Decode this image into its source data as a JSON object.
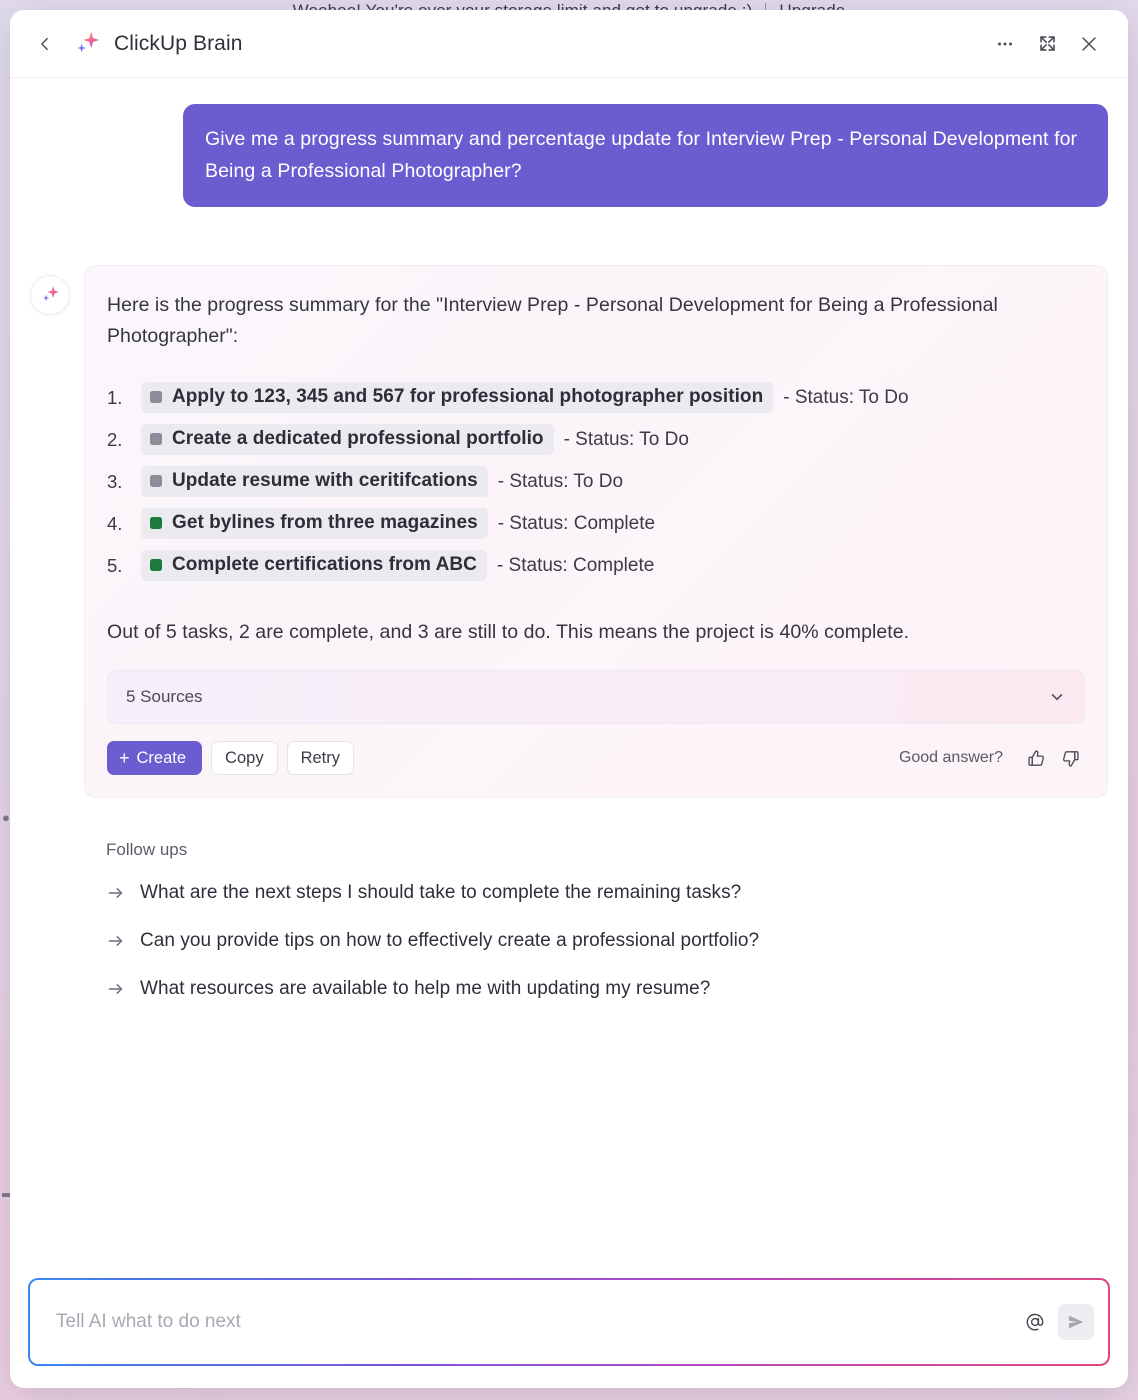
{
  "backdrop": {
    "banner_text": "Woohoo! You're over your storage limit and get to upgrade :)",
    "banner_action": "Upgrade"
  },
  "header": {
    "title": "ClickUp Brain",
    "back_icon": "chevron-left-icon",
    "brand_icon": "sparkles-icon",
    "more_icon": "more-horizontal-icon",
    "expand_icon": "expand-icon",
    "close_icon": "close-icon"
  },
  "conversation": {
    "user_message": "Give me a progress summary and percentage update for Interview Prep - Personal Development for Being a Professional Photographer?",
    "assistant": {
      "intro": "Here is the progress summary for the \"Interview Prep - Personal Development for Being a Professional Photographer\":",
      "tasks": [
        {
          "number": "1.",
          "name": "Apply to 123, 345 and 567 for professional photographer position",
          "status_text": "- Status: To Do",
          "status": "To Do",
          "color": "#8d8d99"
        },
        {
          "number": "2.",
          "name": "Create a dedicated professional portfolio",
          "status_text": "- Status: To Do",
          "status": "To Do",
          "color": "#8d8d99"
        },
        {
          "number": "3.",
          "name": "Update resume with ceritifcations",
          "status_text": "- Status: To Do",
          "status": "To Do",
          "color": "#8d8d99"
        },
        {
          "number": "4.",
          "name": "Get bylines from three magazines",
          "status_text": "- Status: Complete",
          "status": "Complete",
          "color": "#1d7a3e"
        },
        {
          "number": "5.",
          "name": "Complete certifications from ABC",
          "status_text": "- Status: Complete",
          "status": "Complete",
          "color": "#1d7a3e"
        }
      ],
      "summary": "Out of 5 tasks, 2 are complete, and 3 are still to do. This means the project is 40% complete.",
      "sources_label": "5 Sources",
      "sources_chevron_icon": "chevron-down-icon"
    },
    "actions": {
      "create_label": "Create",
      "create_plus": "+",
      "copy_label": "Copy",
      "retry_label": "Retry",
      "feedback_prompt": "Good answer?",
      "thumbs_up_icon": "thumbs-up-icon",
      "thumbs_down_icon": "thumbs-down-icon"
    },
    "followups": {
      "title": "Follow ups",
      "arrow_icon": "arrow-right-icon",
      "items": [
        "What are the next steps I should take to complete the remaining tasks?",
        "Can you provide tips on how to effectively create a professional portfolio?",
        "What resources are available to help me with updating my resume?"
      ]
    }
  },
  "composer": {
    "placeholder": "Tell AI what to do next",
    "value": "",
    "mention_icon": "at-mention-icon",
    "send_icon": "send-icon"
  },
  "colors": {
    "accent_purple": "#6b5cd0",
    "status_todo": "#8d8d99",
    "status_complete": "#1d7a3e"
  }
}
